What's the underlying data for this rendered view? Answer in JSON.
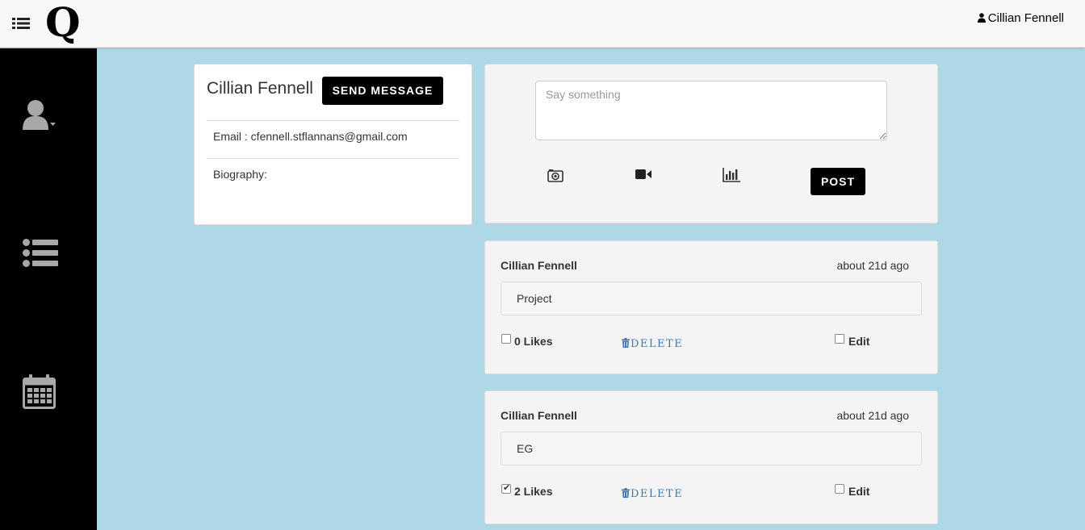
{
  "header": {
    "logo": "Q",
    "user_name": "Cillian Fennell"
  },
  "sidebar": {
    "items": [
      {
        "icon": "user-icon"
      },
      {
        "icon": "list-icon"
      },
      {
        "icon": "calendar-icon"
      }
    ]
  },
  "profile": {
    "name": "Cillian Fennell",
    "send_message_label": "SEND MESSAGE",
    "email_text": "Email : cfennell.stflannans@gmail.com",
    "biography_label": "Biography:"
  },
  "composer": {
    "placeholder": "Say something",
    "tools": [
      "camera-icon",
      "video-icon",
      "chart-icon"
    ],
    "post_label": "POST"
  },
  "posts": [
    {
      "author": "Cillian Fennell",
      "time": "about 21d ago",
      "body": "Project",
      "likes_label": "0 Likes",
      "liked": false,
      "delete_label": "DELETE",
      "edit_label": "Edit"
    },
    {
      "author": "Cillian Fennell",
      "time": "about 21d ago",
      "body": "EG",
      "likes_label": "2 Likes",
      "liked": true,
      "delete_label": "DELETE",
      "edit_label": "Edit"
    }
  ],
  "colors": {
    "page_background": "#add8e6",
    "sidebar": "#000000",
    "link": "#337ab7",
    "button": "#000000"
  }
}
